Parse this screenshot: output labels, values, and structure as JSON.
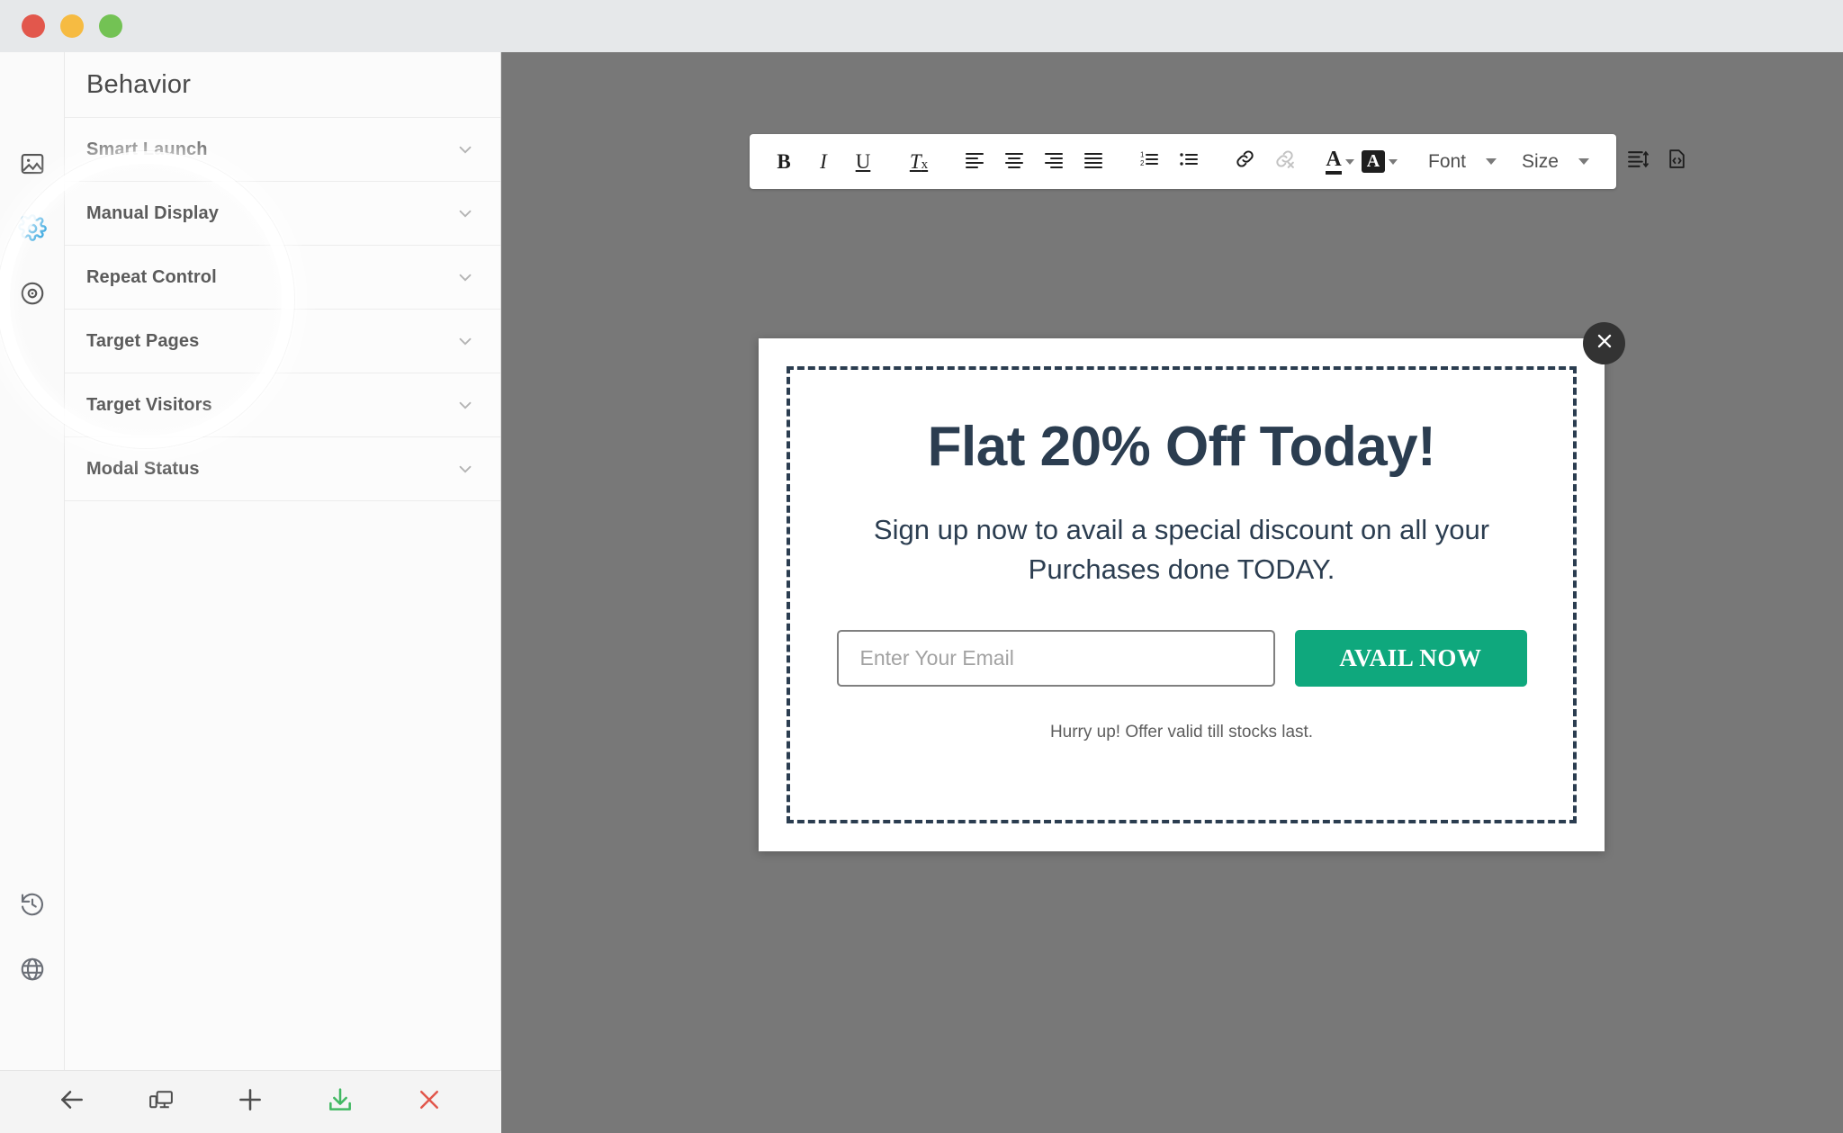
{
  "window": {
    "lights": [
      "close",
      "minimize",
      "maximize"
    ],
    "colors": {
      "close": "#e2574c",
      "minimize": "#f6bb42",
      "maximize": "#73c254",
      "canvas": "#787878",
      "accent_green": "#0fa87d",
      "modal_navy": "#2b3d50",
      "active_icon_blue": "#3aa8e0"
    }
  },
  "rail": {
    "top_items": [
      {
        "name": "image-icon",
        "label": "Appearance",
        "active": false
      },
      {
        "name": "gear-icon",
        "label": "Settings",
        "active": true
      },
      {
        "name": "target-icon",
        "label": "Triggers",
        "active": false
      }
    ],
    "bottom_items": [
      {
        "name": "history-icon",
        "label": "History"
      },
      {
        "name": "globe-icon",
        "label": "Publish"
      }
    ]
  },
  "panel": {
    "title": "Behavior",
    "sections": [
      {
        "label": "Smart Launch"
      },
      {
        "label": "Manual Display"
      },
      {
        "label": "Repeat Control"
      },
      {
        "label": "Target Pages"
      },
      {
        "label": "Target Visitors"
      },
      {
        "label": "Modal Status"
      }
    ]
  },
  "bottombar": {
    "buttons": [
      {
        "name": "back-button",
        "icon": "arrow-left-icon",
        "label": "Back",
        "color": "#4d4d4d"
      },
      {
        "name": "responsive-preview-button",
        "icon": "devices-icon",
        "label": "Responsive Preview",
        "color": "#4d4d4d"
      },
      {
        "name": "add-button",
        "icon": "plus-icon",
        "label": "Add",
        "color": "#4d4d4d"
      },
      {
        "name": "save-button",
        "icon": "download-icon",
        "label": "Save",
        "color": "#41b862"
      },
      {
        "name": "discard-button",
        "icon": "close-x-icon",
        "label": "Discard",
        "color": "#e2574c"
      }
    ]
  },
  "toolbar": {
    "groups": [
      {
        "items": [
          {
            "name": "bold-button",
            "icon": "bold-icon",
            "label": "B"
          },
          {
            "name": "italic-button",
            "icon": "italic-icon",
            "label": "I"
          },
          {
            "name": "underline-button",
            "icon": "underline-icon",
            "label": "U"
          }
        ]
      },
      {
        "items": [
          {
            "name": "remove-format-button",
            "icon": "remove-format-icon",
            "label": "Tx"
          }
        ]
      },
      {
        "items": [
          {
            "name": "align-left-button",
            "icon": "align-left-icon",
            "label": "Align Left"
          },
          {
            "name": "align-center-button",
            "icon": "align-center-icon",
            "label": "Align Center"
          },
          {
            "name": "align-right-button",
            "icon": "align-right-icon",
            "label": "Align Right"
          },
          {
            "name": "align-justify-button",
            "icon": "align-justify-icon",
            "label": "Justify"
          }
        ]
      },
      {
        "items": [
          {
            "name": "ordered-list-button",
            "icon": "ordered-list-icon",
            "label": "Numbered List"
          },
          {
            "name": "unordered-list-button",
            "icon": "unordered-list-icon",
            "label": "Bullet List"
          }
        ]
      },
      {
        "items": [
          {
            "name": "insert-link-button",
            "icon": "link-icon",
            "label": "Insert Link"
          },
          {
            "name": "unlink-button",
            "icon": "unlink-icon",
            "label": "Unlink",
            "disabled": true
          }
        ]
      },
      {
        "items": [
          {
            "name": "text-color-button",
            "icon": "text-color-icon",
            "label": "A"
          },
          {
            "name": "highlight-color-button",
            "icon": "highlight-color-icon",
            "label": "A"
          }
        ]
      }
    ],
    "font_dropdown": {
      "label": "Font"
    },
    "size_dropdown": {
      "label": "Size"
    },
    "line_height_button": {
      "name": "line-height-button",
      "icon": "line-height-icon",
      "label": "Line Height"
    },
    "source_button": {
      "name": "source-code-button",
      "icon": "source-code-icon",
      "label": "Source"
    }
  },
  "modal": {
    "headline": "Flat 20% Off Today!",
    "subtext": "Sign up now to avail a special discount on all your Purchases done TODAY.",
    "email": {
      "value": "",
      "placeholder": "Enter Your Email"
    },
    "cta_label": "AVAIL NOW",
    "note": "Hurry up! Offer valid till stocks last.",
    "close_label": "Close"
  }
}
